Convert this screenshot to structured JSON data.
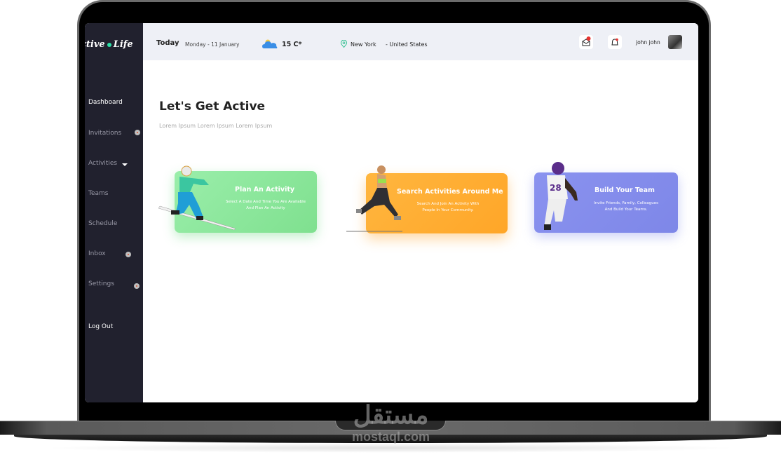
{
  "app": {
    "logo_left": "ctive",
    "logo_right": "Life"
  },
  "topbar": {
    "today_label": "Today",
    "date": "Monday - 11 January",
    "temperature": "15  C*",
    "weather_icon": "partly-cloudy-icon",
    "city": "New York",
    "country": "- United States",
    "username": "john john",
    "notifications": {
      "mail_badge": true,
      "bell_badge": true
    }
  },
  "sidebar": {
    "items": [
      {
        "label": "Dashboard",
        "active": true,
        "badge": false
      },
      {
        "label": "Invitations",
        "active": false,
        "badge": true
      },
      {
        "label": "Activities",
        "active": false,
        "dropdown": true
      },
      {
        "label": "Teams",
        "active": false,
        "badge": false
      },
      {
        "label": "Schedule",
        "active": false,
        "badge": false
      },
      {
        "label": "Inbox",
        "active": false,
        "badge": true
      },
      {
        "label": "Settings",
        "active": false,
        "badge": true
      }
    ],
    "logout_label": "Log Out"
  },
  "main": {
    "title": "Let's Get Active",
    "subtitle": "Lorem Ipsum Lorem Ipsum Lorem Ipsum",
    "cards": [
      {
        "title": "Plan An Activity",
        "desc_line1": "Select A Date And Time You Are Available",
        "desc_line2": "And Plan An Activity",
        "color": "#8de79a",
        "figure": "snowboarder"
      },
      {
        "title": "Search Activities Around Me",
        "desc_line1": "Search And Join An Activity With",
        "desc_line2": "People In Your Community.",
        "color": "#ffb03b",
        "figure": "runner"
      },
      {
        "title": "Build  Your Team",
        "desc_line1": "Invite Friends, Family, Colleagues",
        "desc_line2": "And Build Your Teams.",
        "color": "#8890ec",
        "figure": "football-player"
      }
    ]
  },
  "watermark": {
    "arabic": "مستقل",
    "latin": "mostaql.com"
  }
}
